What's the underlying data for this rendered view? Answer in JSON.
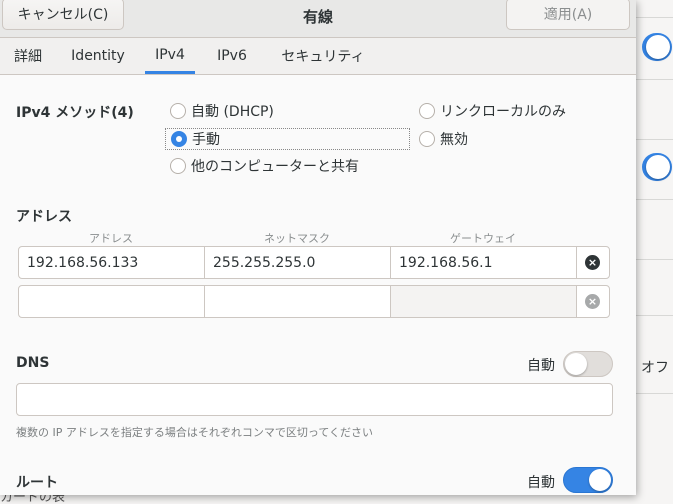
{
  "background": {
    "off_label": "オフ",
    "bottom_text": "カードの表"
  },
  "header": {
    "cancel_label": "キャンセル(C)",
    "title": "有線",
    "apply_label": "適用(A)"
  },
  "tabs": [
    {
      "label": "詳細",
      "active": false
    },
    {
      "label": "Identity",
      "active": false
    },
    {
      "label": "IPv4",
      "active": true
    },
    {
      "label": "IPv6",
      "active": false
    },
    {
      "label": "セキュリティ",
      "active": false
    }
  ],
  "ipv4": {
    "method_label": "IPv4 メソッド(4)",
    "methods": {
      "auto": "自動 (DHCP)",
      "manual": "手動",
      "other": "他のコンピューターと共有",
      "link_local": "リンクローカルのみ",
      "disabled": "無効"
    },
    "selected_method": "manual"
  },
  "addresses": {
    "section_label": "アドレス",
    "columns": [
      "アドレス",
      "ネットマスク",
      "ゲートウェイ"
    ],
    "rows": [
      {
        "address": "192.168.56.133",
        "netmask": "255.255.255.0",
        "gateway": "192.168.56.1"
      },
      {
        "address": "",
        "netmask": "",
        "gateway": ""
      }
    ]
  },
  "dns": {
    "label": "DNS",
    "auto_label": "自動",
    "auto_enabled": false,
    "value": "",
    "hint": "複数の IP アドレスを指定する場合はそれぞれコンマで区切ってください"
  },
  "routes": {
    "label": "ルート",
    "auto_label": "自動",
    "auto_enabled": true
  },
  "colors": {
    "accent": "#3584e4",
    "headerbar": "#e8e8e7",
    "dialog_bg": "#fafafa"
  }
}
